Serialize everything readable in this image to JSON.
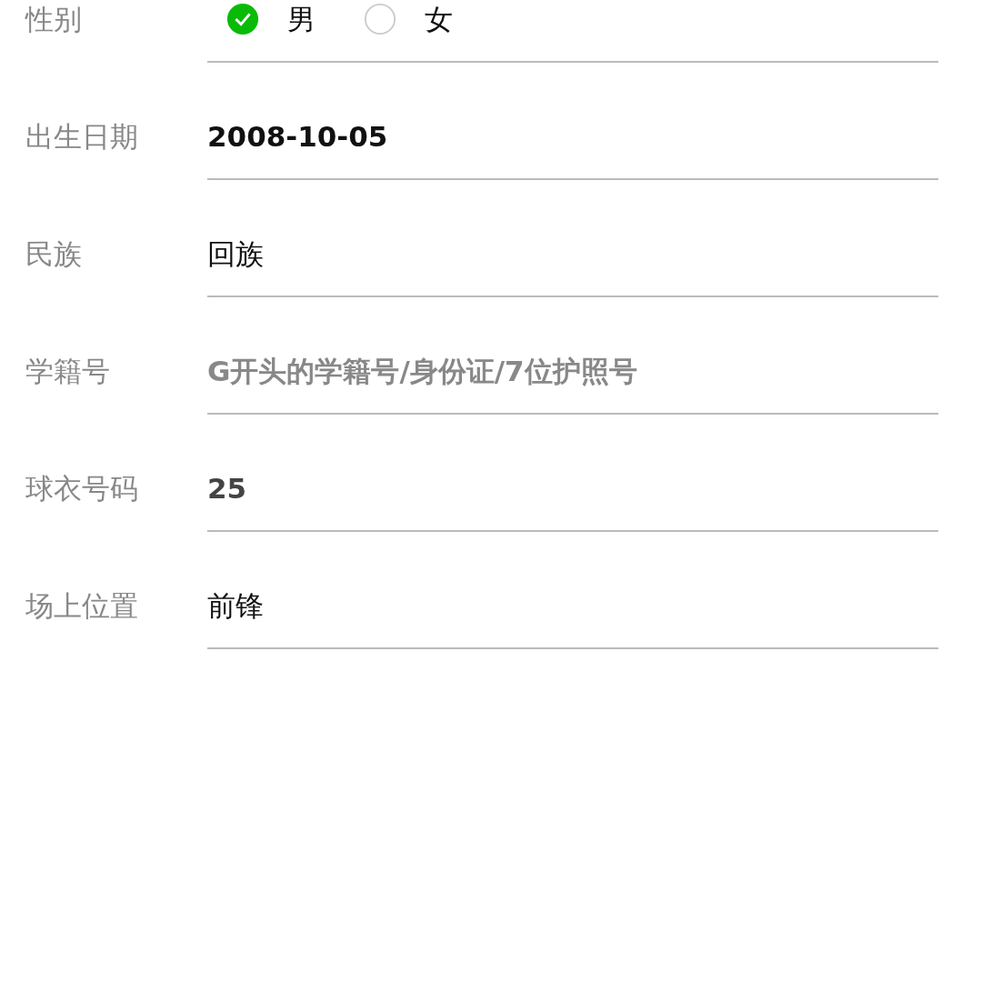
{
  "form": {
    "rows": [
      {
        "kind": "radio",
        "label": "性别",
        "options": [
          {
            "label": "男",
            "selected": true
          },
          {
            "label": "女",
            "selected": false
          }
        ]
      },
      {
        "kind": "date",
        "label": "出生日期",
        "value": "2008-10-05"
      },
      {
        "kind": "select",
        "label": "民族",
        "value": "回族"
      },
      {
        "kind": "input",
        "label": "学籍号",
        "value": "",
        "placeholder": "G开头的学籍号/身份证/7位护照号"
      },
      {
        "kind": "input",
        "label": "球衣号码",
        "value": "25"
      },
      {
        "kind": "select",
        "label": "场上位置",
        "value": "前锋"
      }
    ]
  }
}
